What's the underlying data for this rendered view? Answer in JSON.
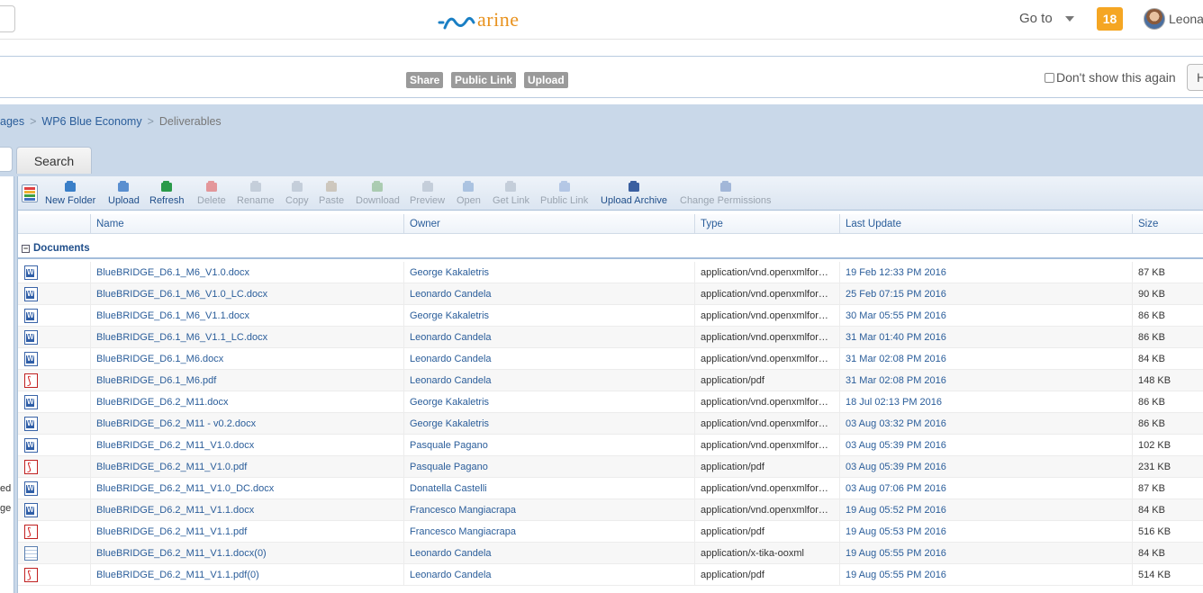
{
  "header": {
    "logo_text": "arine",
    "goto_label": "Go to",
    "notification_count": "18",
    "user_name": "Leonar"
  },
  "banner": {
    "share_label": "Share",
    "public_link_label": "Public Link",
    "upload_label": "Upload",
    "dont_show_label": "Don't show this again",
    "hide_label": "H"
  },
  "breadcrumb": {
    "items": [
      "ages",
      "WP6 Blue Economy"
    ],
    "current": "Deliverables"
  },
  "search": {
    "button_label": "Search"
  },
  "left_panel": {
    "clipped_lines": [
      "ed",
      "ge"
    ]
  },
  "toolbar": {
    "buttons": [
      {
        "label": "New Folder",
        "enabled": true,
        "icon": "new-folder-icon"
      },
      {
        "label": "Upload",
        "enabled": true,
        "icon": "upload-icon"
      },
      {
        "label": "Refresh",
        "enabled": true,
        "icon": "refresh-icon"
      },
      {
        "label": "Delete",
        "enabled": false,
        "icon": "delete-icon"
      },
      {
        "label": "Rename",
        "enabled": false,
        "icon": "rename-icon"
      },
      {
        "label": "Copy",
        "enabled": false,
        "icon": "copy-icon"
      },
      {
        "label": "Paste",
        "enabled": false,
        "icon": "paste-icon"
      },
      {
        "label": "Download",
        "enabled": false,
        "icon": "download-icon"
      },
      {
        "label": "Preview",
        "enabled": false,
        "icon": "preview-icon"
      },
      {
        "label": "Open",
        "enabled": false,
        "icon": "open-icon"
      },
      {
        "label": "Get Link",
        "enabled": false,
        "icon": "get-link-icon"
      },
      {
        "label": "Public Link",
        "enabled": false,
        "icon": "public-link-icon"
      },
      {
        "label": "Upload Archive",
        "enabled": true,
        "icon": "upload-archive-icon"
      },
      {
        "label": "Change Permissions",
        "enabled": false,
        "icon": "change-permissions-icon"
      }
    ]
  },
  "columns": {
    "name": "Name",
    "owner": "Owner",
    "type": "Type",
    "last_update": "Last Update",
    "size": "Size"
  },
  "group_label": "Documents",
  "files": [
    {
      "icon": "word",
      "name": "BlueBRIDGE_D6.1_M6_V1.0.docx",
      "owner": "George Kakaletris",
      "type": "application/vnd.openxmlfor…",
      "date": "19 Feb 12:33 PM 2016",
      "size": "87 KB"
    },
    {
      "icon": "word",
      "name": "BlueBRIDGE_D6.1_M6_V1.0_LC.docx",
      "owner": "Leonardo Candela",
      "type": "application/vnd.openxmlfor…",
      "date": "25 Feb 07:15 PM 2016",
      "size": "90 KB"
    },
    {
      "icon": "word",
      "name": "BlueBRIDGE_D6.1_M6_V1.1.docx",
      "owner": "George Kakaletris",
      "type": "application/vnd.openxmlfor…",
      "date": "30 Mar 05:55 PM 2016",
      "size": "86 KB"
    },
    {
      "icon": "word",
      "name": "BlueBRIDGE_D6.1_M6_V1.1_LC.docx",
      "owner": "Leonardo Candela",
      "type": "application/vnd.openxmlfor…",
      "date": "31 Mar 01:40 PM 2016",
      "size": "86 KB"
    },
    {
      "icon": "word",
      "name": "BlueBRIDGE_D6.1_M6.docx",
      "owner": "Leonardo Candela",
      "type": "application/vnd.openxmlfor…",
      "date": "31 Mar 02:08 PM 2016",
      "size": "84 KB"
    },
    {
      "icon": "pdf",
      "name": "BlueBRIDGE_D6.1_M6.pdf",
      "owner": "Leonardo Candela",
      "type": "application/pdf",
      "date": "31 Mar 02:08 PM 2016",
      "size": "148 KB"
    },
    {
      "icon": "word",
      "name": "BlueBRIDGE_D6.2_M11.docx",
      "owner": "George Kakaletris",
      "type": "application/vnd.openxmlfor…",
      "date": "18 Jul 02:13 PM 2016",
      "size": "86 KB"
    },
    {
      "icon": "word",
      "name": "BlueBRIDGE_D6.2_M11 - v0.2.docx",
      "owner": "George Kakaletris",
      "type": "application/vnd.openxmlfor…",
      "date": "03 Aug 03:32 PM 2016",
      "size": "86 KB"
    },
    {
      "icon": "word",
      "name": "BlueBRIDGE_D6.2_M11_V1.0.docx",
      "owner": "Pasquale Pagano",
      "type": "application/vnd.openxmlfor…",
      "date": "03 Aug 05:39 PM 2016",
      "size": "102 KB"
    },
    {
      "icon": "pdf",
      "name": "BlueBRIDGE_D6.2_M11_V1.0.pdf",
      "owner": "Pasquale Pagano",
      "type": "application/pdf",
      "date": "03 Aug 05:39 PM 2016",
      "size": "231 KB"
    },
    {
      "icon": "word",
      "name": "BlueBRIDGE_D6.2_M11_V1.0_DC.docx",
      "owner": "Donatella Castelli",
      "type": "application/vnd.openxmlfor…",
      "date": "03 Aug 07:06 PM 2016",
      "size": "87 KB"
    },
    {
      "icon": "word",
      "name": "BlueBRIDGE_D6.2_M11_V1.1.docx",
      "owner": "Francesco Mangiacrapa",
      "type": "application/vnd.openxmlfor…",
      "date": "19 Aug 05:52 PM 2016",
      "size": "84 KB"
    },
    {
      "icon": "pdf",
      "name": "BlueBRIDGE_D6.2_M11_V1.1.pdf",
      "owner": "Francesco Mangiacrapa",
      "type": "application/pdf",
      "date": "19 Aug 05:53 PM 2016",
      "size": "516 KB"
    },
    {
      "icon": "generic",
      "name": "BlueBRIDGE_D6.2_M11_V1.1.docx(0)",
      "owner": "Leonardo Candela",
      "type": "application/x-tika-ooxml",
      "date": "19 Aug 05:55 PM 2016",
      "size": "84 KB"
    },
    {
      "icon": "pdf",
      "name": "BlueBRIDGE_D6.2_M11_V1.1.pdf(0)",
      "owner": "Leonardo Candela",
      "type": "application/pdf",
      "date": "19 Aug 05:55 PM 2016",
      "size": "514 KB"
    }
  ]
}
